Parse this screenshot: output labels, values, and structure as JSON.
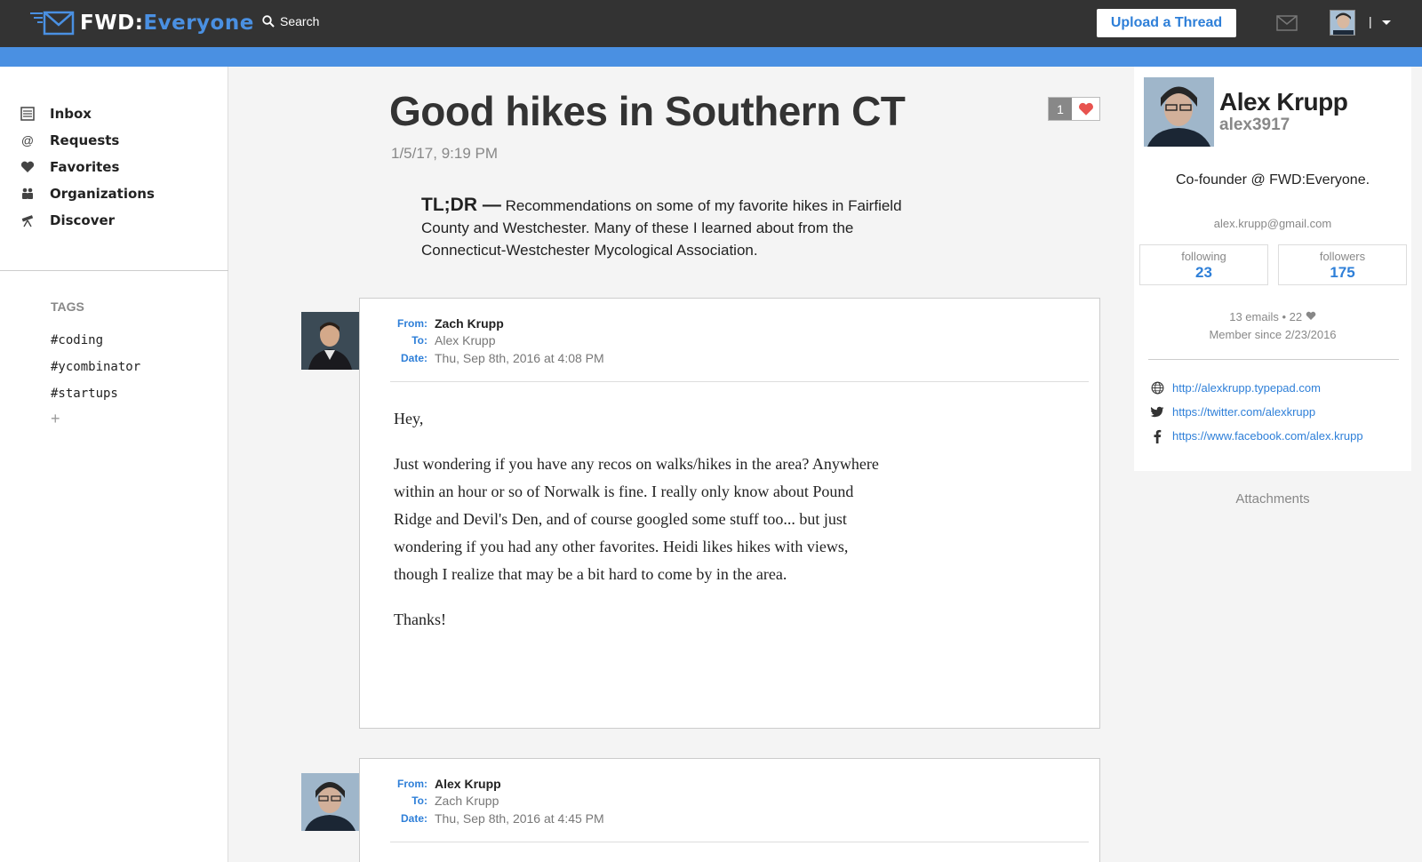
{
  "header": {
    "logo_main": "FWD",
    "logo_colon": ":",
    "logo_accent": "Everyone",
    "search_label": "Search",
    "upload_label": "Upload a Thread",
    "divider": "|"
  },
  "sidebar": {
    "nav": [
      {
        "label": "Inbox",
        "icon": "inbox-icon"
      },
      {
        "label": "Requests",
        "icon": "at-icon"
      },
      {
        "label": "Favorites",
        "icon": "heart-icon"
      },
      {
        "label": "Organizations",
        "icon": "people-icon"
      },
      {
        "label": "Discover",
        "icon": "telescope-icon"
      }
    ],
    "tags_title": "TAGS",
    "tags": [
      "#coding",
      "#ycombinator",
      "#startups"
    ],
    "add_tag": "+"
  },
  "thread": {
    "title": "Good hikes in Southern CT",
    "date": "1/5/17, 9:19 PM",
    "like_count": "1",
    "tldr_label": "TL;DR —",
    "tldr_text": "Recommendations on some of my favorite hikes in Fairfield County and Westchester. Many of these I learned about from the Connecticut-Westchester Mycological Association."
  },
  "messages": [
    {
      "from_label": "From:",
      "from": "Zach Krupp",
      "to_label": "To:",
      "to": "Alex Krupp",
      "date_label": "Date:",
      "date": "Thu, Sep 8th, 2016 at 4:08 PM",
      "body": [
        "Hey,",
        "Just wondering if you have any recos on walks/hikes in the area? Anywhere within an hour or so of Norwalk is fine. I really only know about Pound Ridge and Devil's Den, and of course googled some stuff too... but just wondering if you had any other favorites. Heidi likes hikes with views, though I realize that may be a bit hard to come by in the area.",
        "Thanks!"
      ]
    },
    {
      "from_label": "From:",
      "from": "Alex Krupp",
      "to_label": "To:",
      "to": "Zach Krupp",
      "date_label": "Date:",
      "date": "Thu, Sep 8th, 2016 at 4:45 PM"
    }
  ],
  "profile": {
    "name": "Alex Krupp",
    "handle": "alex3917",
    "bio": "Co-founder @ FWD:Everyone.",
    "email": "alex.krupp@gmail.com",
    "following_label": "following",
    "following": "23",
    "followers_label": "followers",
    "followers": "175",
    "emails": "13 emails",
    "bullet": "•",
    "likes": "22",
    "member_since": "Member since 2/23/2016",
    "links": [
      {
        "icon": "globe-icon",
        "url": "http://alexkrupp.typepad.com"
      },
      {
        "icon": "twitter-icon",
        "url": "https://twitter.com/alexkrupp"
      },
      {
        "icon": "facebook-icon",
        "url": "https://www.facebook.com/alex.krupp"
      }
    ]
  },
  "attachments_label": "Attachments",
  "colors": {
    "topbar": "#333333",
    "accent_blue": "#4a90e2",
    "link_blue": "#2e7fd8",
    "heart": "#e8534f"
  }
}
